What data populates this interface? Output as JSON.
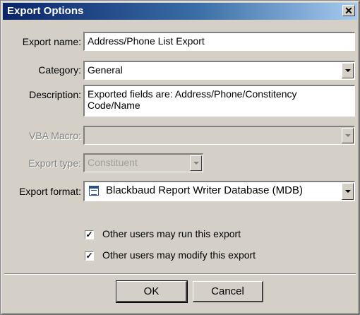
{
  "dialog": {
    "title": "Export Options",
    "close_glyph": "✕"
  },
  "fields": {
    "export_name": {
      "label": "Export name:",
      "value": "Address/Phone List Export"
    },
    "category": {
      "label": "Category:",
      "value": "General"
    },
    "description": {
      "label": "Description:",
      "value": "Exported fields are: Address/Phone/Constitency Code/Name"
    },
    "vba_macro": {
      "label": "VBA Macro:",
      "value": ""
    },
    "export_type": {
      "label": "Export type:",
      "value": "Constituent"
    },
    "export_format": {
      "label": "Export format:",
      "value": "Blackbaud Report Writer Database (MDB)",
      "icon": "database-file-icon"
    }
  },
  "options": {
    "run_label": "Other users may run this export",
    "run_checked": true,
    "modify_label": "Other users may modify this export",
    "modify_checked": true
  },
  "buttons": {
    "ok": "OK",
    "cancel": "Cancel"
  }
}
